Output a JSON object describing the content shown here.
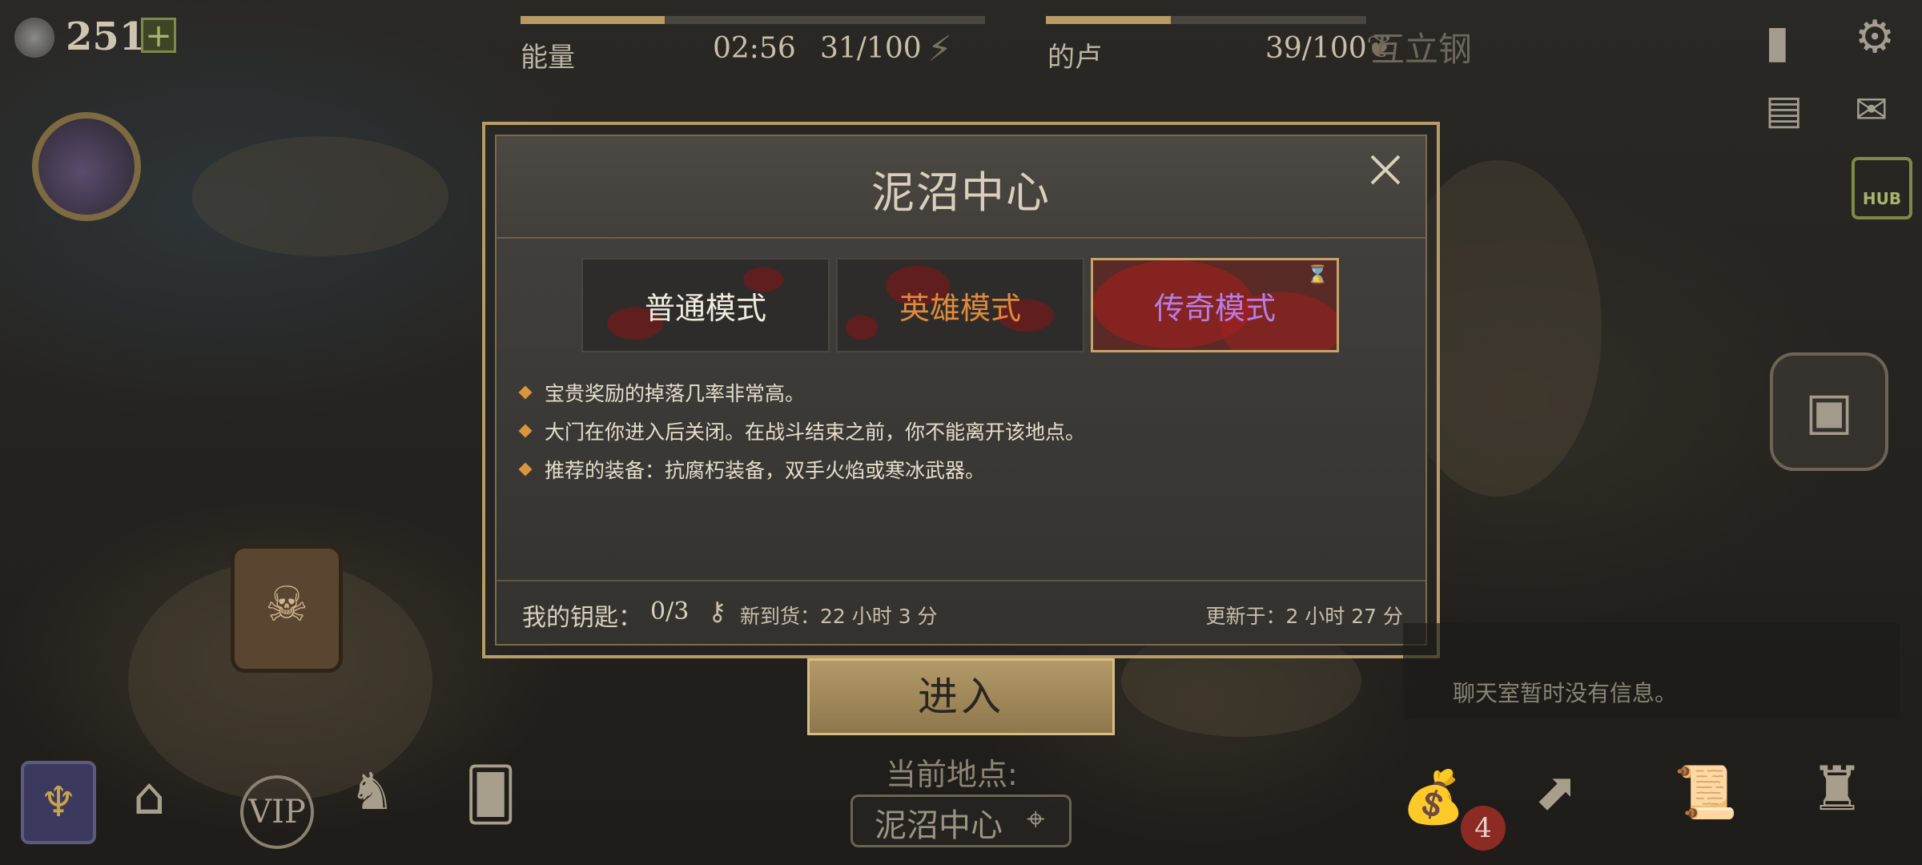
{
  "top_bar": {
    "coins": "251",
    "add_label": "+",
    "energy": {
      "label": "能量",
      "timer": "02:56",
      "value": "31/100",
      "fill": 0.31
    },
    "second": {
      "label": "的卢",
      "value": "39/100",
      "fill": 0.39
    },
    "partial_text": "互立钢"
  },
  "modal": {
    "title": "泥沼中心",
    "tabs": [
      {
        "label": "普通模式",
        "color": "#f2ece0",
        "selected": false
      },
      {
        "label": "英雄模式",
        "color": "#e08a3c",
        "selected": false
      },
      {
        "label": "传奇模式",
        "color": "#b57ee6",
        "selected": true
      }
    ],
    "bullets": [
      "宝贵奖励的掉落几率非常高。",
      "大门在你进入后关闭。在战斗结束之前，你不能离开该地点。",
      "推荐的装备：抗腐朽装备，双手火焰或寒冰武器。"
    ],
    "footer": {
      "keys_label": "我的钥匙：",
      "keys_value": "0/3",
      "restock": "新到货：22 小时 3 分",
      "updated": "更新于：2 小时 27 分"
    }
  },
  "enter_button": "进入",
  "location": {
    "label": "当前地点:",
    "value": "泥沼中心"
  },
  "chat": {
    "empty_text": "聊天室暂时没有信息。"
  },
  "bottom_icons": {
    "vip_label": "VIP",
    "bag_badge": "4"
  },
  "hub_label": "HUB",
  "colors": {
    "accent_gold": "#b69d68",
    "legendary": "#b57ee6",
    "heroic": "#e08a3c",
    "badge_red": "#8c2a24"
  }
}
